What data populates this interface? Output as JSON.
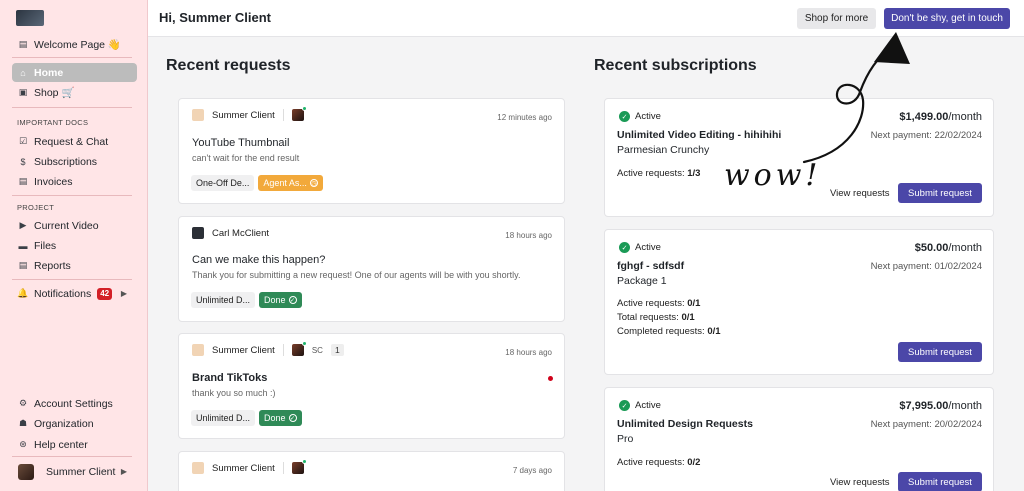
{
  "sidebar": {
    "welcome": "Welcome Page 👋",
    "home": "Home",
    "shop": "Shop 🛒",
    "section_important": "IMPORTANT DOCS",
    "request_chat": "Request & Chat",
    "subscriptions": "Subscriptions",
    "invoices": "Invoices",
    "section_project": "PROJECT",
    "current_video": "Current Video",
    "files": "Files",
    "reports": "Reports",
    "notifications": "Notifications",
    "notifications_count": "42",
    "account_settings": "Account Settings",
    "organization": "Organization",
    "help_center": "Help center",
    "user": "Summer Client"
  },
  "topbar": {
    "greeting": "Hi, Summer Client",
    "shop_btn": "Shop for more",
    "contact_btn": "Don't be shy, get in touch"
  },
  "requests": {
    "title": "Recent requests",
    "items": [
      {
        "user": "Summer Client",
        "time": "12 minutes ago",
        "title": "YouTube Thumbnail",
        "subtitle": "can't wait for the end result",
        "tag1": "One-Off De...",
        "tag2": "Agent As..."
      },
      {
        "user": "Carl McClient",
        "time": "18 hours ago",
        "title": "Can we make this happen?",
        "subtitle": "Thank you for submitting a new request! One of our agents will be with you shortly.",
        "tag1": "Unlimited D...",
        "tag2": "Done"
      },
      {
        "user": "Summer Client",
        "initials": "SC",
        "count": "1",
        "time": "18 hours ago",
        "title": "Brand TikToks",
        "subtitle": "thank you so much :)",
        "tag1": "Unlimited D...",
        "tag2": "Done"
      },
      {
        "user": "Summer Client",
        "time": "7 days ago"
      }
    ]
  },
  "subscriptions": {
    "title": "Recent subscriptions",
    "active_label": "Active",
    "per": "/month",
    "view_requests": "View requests",
    "submit_request": "Submit request",
    "items": [
      {
        "price": "$1,499.00",
        "next": "Next payment: 22/02/2024",
        "name": "Unlimited Video Editing - hihihihi",
        "plan": "Parmesian Crunchy",
        "stat1_label": "Active requests:",
        "stat1_value": "1/3"
      },
      {
        "price": "$50.00",
        "next": "Next payment: 01/02/2024",
        "name": "fghgf - sdfsdf",
        "plan": "Package 1",
        "stat1_label": "Active requests:",
        "stat1_value": "0/1",
        "stat2_label": "Total requests:",
        "stat2_value": "0/1",
        "stat3_label": "Completed requests:",
        "stat3_value": "0/1"
      },
      {
        "price": "$7,995.00",
        "next": "Next payment: 20/02/2024",
        "name": "Unlimited Design Requests",
        "plan": "Pro",
        "stat1_label": "Active requests:",
        "stat1_value": "0/2"
      }
    ]
  },
  "annotation": "wow!",
  "colors": {
    "sidebar_bg": "#ffe5e7",
    "accent": "#4b47a8",
    "done": "#2f8a57",
    "agent": "#f2a93b",
    "active_check": "#1a9a56"
  }
}
